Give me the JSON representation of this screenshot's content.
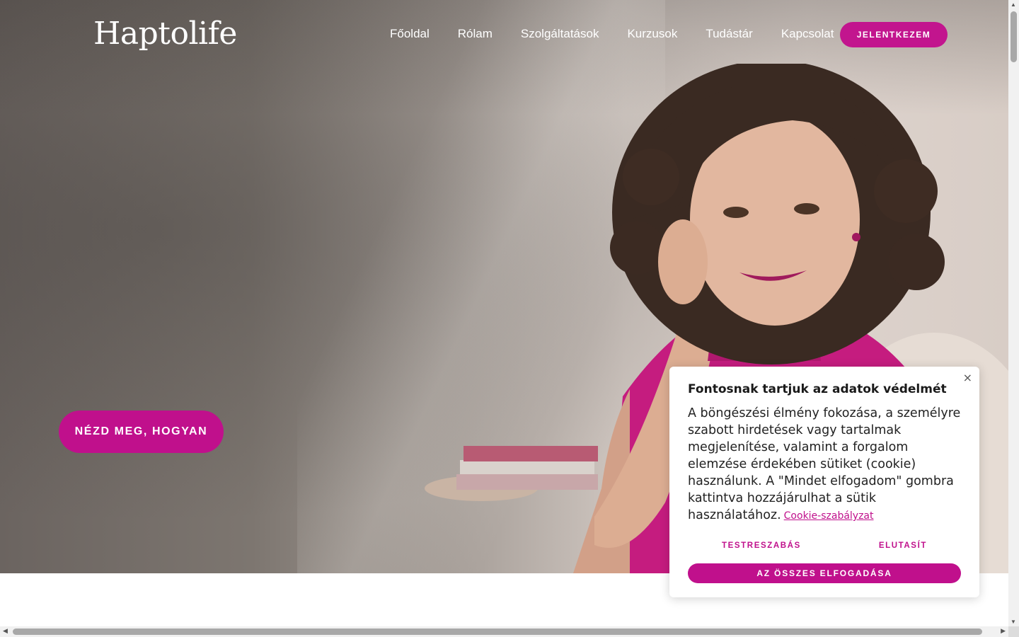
{
  "header": {
    "logo": "Haptolife",
    "nav": [
      "Főoldal",
      "Rólam",
      "Szolgáltatások",
      "Kurzusok",
      "Tudástár",
      "Kapcsolat"
    ],
    "cta": "JELENTKEZEM"
  },
  "hero": {
    "cta": "NÉZD MEG, HOGYAN",
    "image": "portrait of a smiling woman with curly hair in a magenta top"
  },
  "cookie": {
    "close": "×",
    "title": "Fontosnak tartjuk az adatok védelmét",
    "body": "A böngészési élmény fokozása, a személyre szabott hirdetések vagy tartalmak megjelenítése, valamint a forgalom elemzése érdekében sütiket (cookie) használunk. A \"Mindet elfogadom\" gombra kattintva hozzájárulhat a sütik használatához.",
    "link": "Cookie-szabályzat",
    "customize": "TESTRESZABÁS",
    "reject": "ELUTASÍT",
    "accept": "AZ ÖSSZES ELFOGADÁSA"
  },
  "colors": {
    "accent": "#c0108c",
    "accent_light": "#c2158e"
  },
  "icons": {
    "close": "close-icon"
  }
}
